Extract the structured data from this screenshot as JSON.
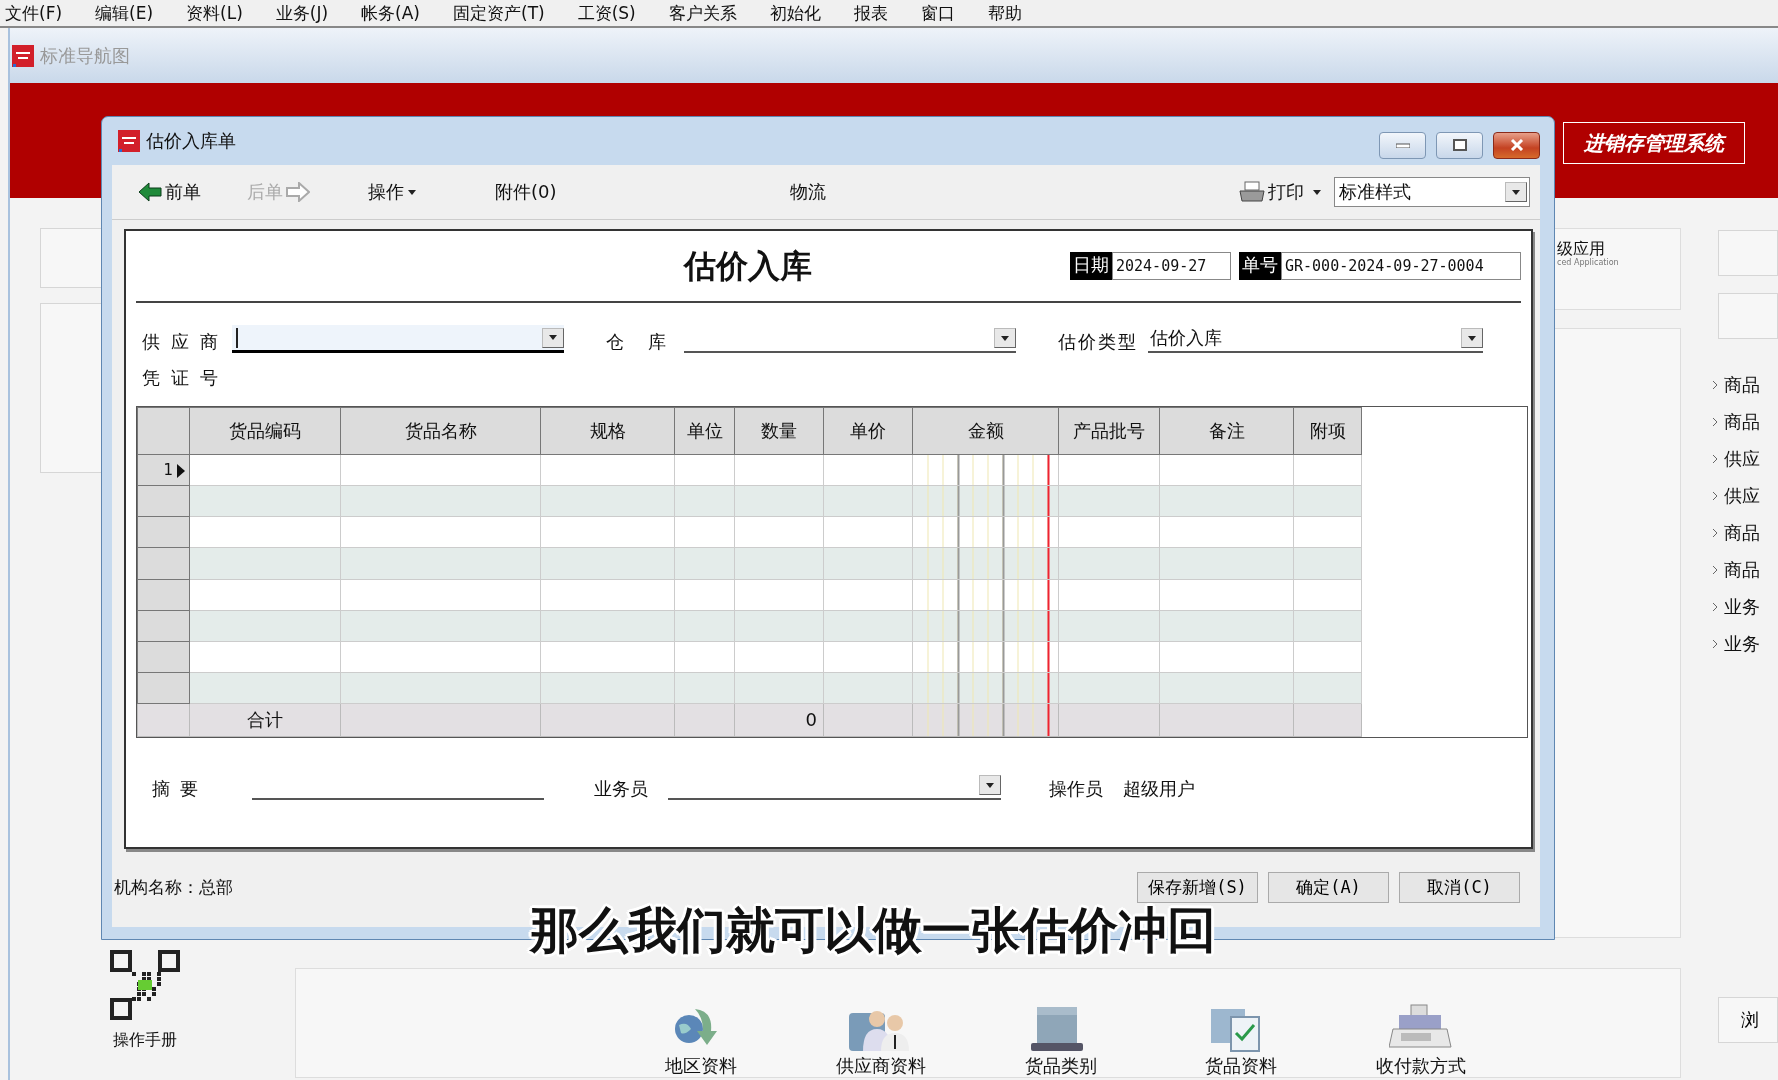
{
  "menu_bar": [
    "文件(F)",
    "编辑(E)",
    "资料(L)",
    "业务(J)",
    "帐务(A)",
    "固定资产(T)",
    "工资(S)",
    "客户关系",
    "初始化",
    "报表",
    "窗口",
    "帮助"
  ],
  "nav_window": {
    "title": "标准导航图"
  },
  "banner_button": "进销存管理系统",
  "feature_card": {
    "title": "级应用",
    "subtitle": "ced Application"
  },
  "side_menu": [
    "商品",
    "商品",
    "供应",
    "供应",
    "商品",
    "商品",
    "业务",
    "业务"
  ],
  "side_button": "浏",
  "manual": "操作手册",
  "shortcuts": [
    {
      "label": "地区资料",
      "kind": "globe"
    },
    {
      "label": "供应商资料",
      "kind": "people"
    },
    {
      "label": "货品类别",
      "kind": "box"
    },
    {
      "label": "货品资料",
      "kind": "checklist"
    },
    {
      "label": "收付款方式",
      "kind": "register"
    }
  ],
  "dialog": {
    "title": "估价入库单",
    "toolbar": [
      {
        "label": "前单",
        "kind": "prev",
        "disabled": false
      },
      {
        "label": "后单",
        "kind": "next",
        "disabled": true
      },
      {
        "label": "操作",
        "kind": "menu",
        "disabled": false
      },
      {
        "label": "附件(0)",
        "kind": "plain",
        "disabled": false
      },
      {
        "label": "物流",
        "kind": "plain",
        "disabled": false
      }
    ],
    "print": "打印",
    "style_select": "标准样式",
    "form_title": "估价入库",
    "date_label": "日期",
    "date": "2024-09-27",
    "number_label": "单号",
    "number": "GR-000-2024-09-27-0004",
    "fields": [
      {
        "label": "供 应 商",
        "kind": "dropdown",
        "focused": true
      },
      {
        "label": "仓 库",
        "kind": "dropdown",
        "focused": false
      },
      {
        "label": "估价类型",
        "kind": "dropdown",
        "focused": false,
        "value": "估价入库"
      },
      {
        "label": "凭 证 号",
        "kind": "plain",
        "focused": false
      }
    ],
    "grid": {
      "columns": [
        "货品编码",
        "货品名称",
        "规格",
        "单位",
        "数量",
        "单价",
        "金额",
        "产品批号",
        "备注",
        "附项"
      ],
      "rows": [
        {
          "number": "1",
          "current": true
        },
        {
          "current": false
        },
        {
          "current": false
        },
        {
          "current": false
        },
        {
          "current": false
        },
        {
          "current": false
        },
        {
          "current": false
        },
        {
          "current": false
        }
      ],
      "total_label": "合计",
      "total_quantity": "0"
    },
    "footer_fields": [
      {
        "label": "摘 要",
        "kind": "text"
      },
      {
        "label": "业务员",
        "kind": "dropdown"
      },
      {
        "label": "操作员",
        "kind": "readonly",
        "value": "超级用户"
      }
    ],
    "org": "机构名称：总部",
    "buttons": [
      "保存新增(S)",
      "确定(A)",
      "取消(C)"
    ]
  },
  "caption": "那么我们就可以做一张估价冲回"
}
